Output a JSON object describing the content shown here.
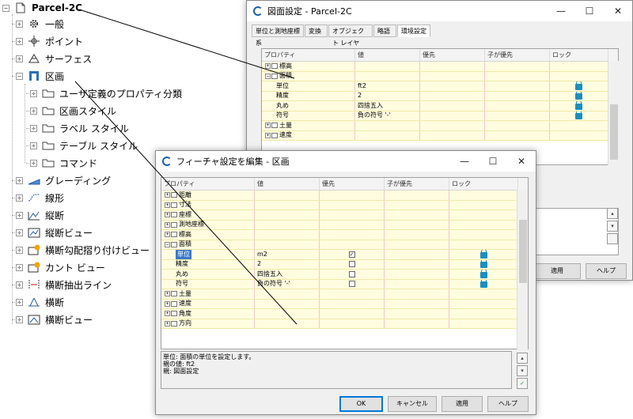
{
  "tree": {
    "root": "Parcel-2C",
    "items": [
      {
        "label": "一般",
        "icon": "gear-icon"
      },
      {
        "label": "ポイント",
        "icon": "point-icon"
      },
      {
        "label": "サーフェス",
        "icon": "surface-icon"
      },
      {
        "label": "区画",
        "icon": "parcel-icon"
      },
      {
        "label": "ユーザ定義のプロパティ分類",
        "icon": "folder-icon"
      },
      {
        "label": "区画スタイル",
        "icon": "folder-icon"
      },
      {
        "label": "ラベル スタイル",
        "icon": "folder-icon"
      },
      {
        "label": "テーブル スタイル",
        "icon": "folder-icon"
      },
      {
        "label": "コマンド",
        "icon": "folder-icon"
      },
      {
        "label": "グレーディング",
        "icon": "grading-icon"
      },
      {
        "label": "線形",
        "icon": "alignment-icon"
      },
      {
        "label": "縦断",
        "icon": "profile-icon"
      },
      {
        "label": "縦断ビュー",
        "icon": "profile-view-icon"
      },
      {
        "label": "横断勾配摺り付けビュー",
        "icon": "superelevation-view-icon"
      },
      {
        "label": "カント ビュー",
        "icon": "cant-view-icon"
      },
      {
        "label": "横断抽出ライン",
        "icon": "sample-line-icon"
      },
      {
        "label": "横断",
        "icon": "section-icon"
      },
      {
        "label": "横断ビュー",
        "icon": "section-view-icon"
      }
    ],
    "expander_collapsed": "+",
    "expander_expanded": "−"
  },
  "back_dialog": {
    "title": "図面設定 - Parcel-2C",
    "tabs": [
      "単位と測地座標系",
      "変換",
      "オブジェクト レイヤ",
      "略語",
      "環境設定"
    ],
    "columns": [
      "プロパティ",
      "値",
      "優先",
      "子が優先",
      "ロック"
    ],
    "rows": [
      {
        "label": "標高",
        "value": "",
        "level": 0,
        "expander": "+"
      },
      {
        "label": "面積",
        "value": "",
        "level": 0,
        "expander": "−"
      },
      {
        "label": "単位",
        "value": "ft2",
        "level": 1,
        "lock": true
      },
      {
        "label": "精度",
        "value": "2",
        "level": 1,
        "lock": true
      },
      {
        "label": "丸め",
        "value": "四捨五入",
        "level": 1,
        "lock": true
      },
      {
        "label": "符号",
        "value": "負の符号 '-'",
        "level": 1,
        "lock": true
      },
      {
        "label": "土量",
        "value": "",
        "level": 0,
        "expander": "+"
      },
      {
        "label": "速度",
        "value": "",
        "level": 0,
        "expander": "+"
      }
    ],
    "buttons": {
      "apply": "適用",
      "help": "ヘルプ"
    }
  },
  "front_dialog": {
    "title": "フィーチャ設定を編集 - 区画",
    "columns": [
      "プロパティ",
      "値",
      "優先",
      "子が優先",
      "ロック"
    ],
    "rows": [
      {
        "label": "距離",
        "value": "",
        "level": 0,
        "expander": "+"
      },
      {
        "label": "寸法",
        "value": "",
        "level": 0,
        "expander": "+"
      },
      {
        "label": "座標",
        "value": "",
        "level": 0,
        "expander": "+"
      },
      {
        "label": "測地座標",
        "value": "",
        "level": 0,
        "expander": "+"
      },
      {
        "label": "標高",
        "value": "",
        "level": 0,
        "expander": "+"
      },
      {
        "label": "面積",
        "value": "",
        "level": 0,
        "expander": "−"
      },
      {
        "label": "単位",
        "value": "m2",
        "level": 1,
        "override": true,
        "lock": true,
        "selected": true
      },
      {
        "label": "精度",
        "value": "2",
        "level": 1,
        "override": false,
        "lock": true
      },
      {
        "label": "丸め",
        "value": "四捨五入",
        "level": 1,
        "override": false,
        "lock": true
      },
      {
        "label": "符号",
        "value": "負の符号 '-'",
        "level": 1,
        "override": false,
        "lock": true
      },
      {
        "label": "土量",
        "value": "",
        "level": 0,
        "expander": "+"
      },
      {
        "label": "速度",
        "value": "",
        "level": 0,
        "expander": "+"
      },
      {
        "label": "角度",
        "value": "",
        "level": 0,
        "expander": "+"
      },
      {
        "label": "方向",
        "value": "",
        "level": 0,
        "expander": "+"
      }
    ],
    "description": [
      "単位: 面積の単位を設定します。",
      "親の値: ft2",
      "親: 図面設定"
    ],
    "buttons": {
      "ok": "OK",
      "cancel": "キャンセル",
      "apply": "適用",
      "help": "ヘルプ"
    },
    "checkmark": "✓"
  },
  "window_controls": {
    "minimize": "—",
    "maximize": "☐",
    "close": "✕"
  },
  "colors": {
    "accent": "#1a5ea8",
    "grid_bg": "#fffce0",
    "lock": "#1a8fc0"
  }
}
